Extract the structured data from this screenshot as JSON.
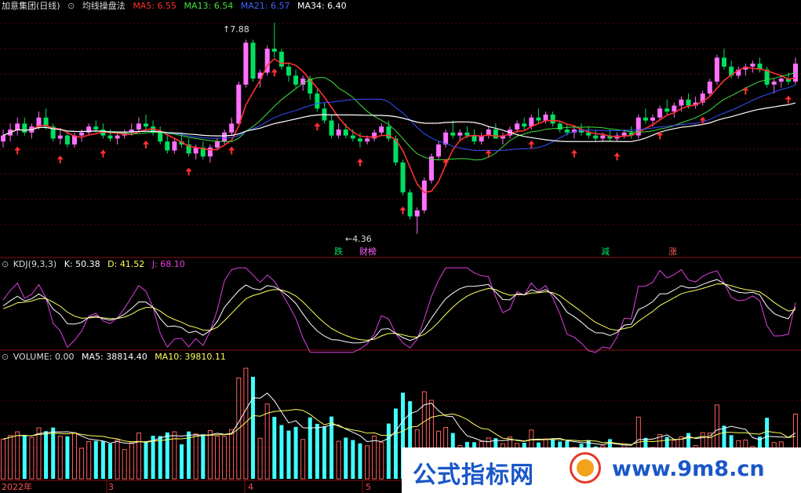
{
  "main_header": {
    "stock": "加意集团(日线)",
    "indicator": "均线操盘法",
    "ma5": "MA5: 6.55",
    "ma13": "MA13: 6.54",
    "ma21": "MA21: 6.57",
    "ma34": "MA34: 6.40"
  },
  "kdj_header": {
    "name": "KDJ(9,3,3)",
    "k": "K: 50.38",
    "d": "D: 41.52",
    "j": "J: 68.10"
  },
  "vol_header": {
    "name": "VOLUME: 0.00",
    "ma5": "MA5: 38814.40",
    "ma10": "MA10: 39810.11"
  },
  "annotations": {
    "high": "7.88",
    "low": "4.36"
  },
  "signals": [
    {
      "text": "跌",
      "color": "#00e060"
    },
    {
      "text": "财榜",
      "color": "#ff60ff"
    },
    {
      "text": "減",
      "color": "#00e060"
    },
    {
      "text": "涨",
      "color": "#ff6060"
    }
  ],
  "x_axis_labels": [
    "2022年",
    "3",
    "4",
    "5"
  ],
  "watermark": {
    "text1": "公式指标网",
    "text2": "www.9m8.cn"
  },
  "colors": {
    "up": "#ff70ff",
    "down": "#00e060",
    "ma5": "#ff3030",
    "ma13": "#40e040",
    "ma21": "#3050ff",
    "ma34": "#ffffff",
    "k": "#ffffff",
    "d": "#ffff60",
    "j": "#e040e0",
    "vol_up": "#ff6060",
    "vol_down": "#40ffff"
  },
  "chart_data": [
    {
      "type": "candlestick",
      "title": "均线操盘法",
      "series": [
        {
          "name": "MA5",
          "values": [
            6.55
          ]
        },
        {
          "name": "MA13",
          "values": [
            6.54
          ]
        },
        {
          "name": "MA21",
          "values": [
            6.57
          ]
        },
        {
          "name": "MA34",
          "values": [
            6.4
          ]
        }
      ],
      "ohlc": [
        [
          5.9,
          6.1,
          5.8,
          6.0
        ],
        [
          6.0,
          6.2,
          5.9,
          6.1
        ],
        [
          6.1,
          6.3,
          6.0,
          6.2
        ],
        [
          6.2,
          6.3,
          6.0,
          6.05
        ],
        [
          6.05,
          6.2,
          5.95,
          6.15
        ],
        [
          6.15,
          6.4,
          6.1,
          6.3
        ],
        [
          6.3,
          6.45,
          6.1,
          6.15
        ],
        [
          6.15,
          6.2,
          5.9,
          5.95
        ],
        [
          5.95,
          6.1,
          5.85,
          6.0
        ],
        [
          6.0,
          6.05,
          5.8,
          5.85
        ],
        [
          5.85,
          6.05,
          5.8,
          6.0
        ],
        [
          6.0,
          6.1,
          5.9,
          6.05
        ],
        [
          6.05,
          6.2,
          6.0,
          6.15
        ],
        [
          6.15,
          6.25,
          6.05,
          6.1
        ],
        [
          6.1,
          6.2,
          5.95,
          6.0
        ],
        [
          6.0,
          6.1,
          5.9,
          5.95
        ],
        [
          5.95,
          6.05,
          5.85,
          6.0
        ],
        [
          6.0,
          6.1,
          5.95,
          6.05
        ],
        [
          6.05,
          6.2,
          6.0,
          6.1
        ],
        [
          6.1,
          6.3,
          6.05,
          6.2
        ],
        [
          6.2,
          6.35,
          6.1,
          6.15
        ],
        [
          6.15,
          6.25,
          6.0,
          6.05
        ],
        [
          6.05,
          6.15,
          5.85,
          5.9
        ],
        [
          5.9,
          6.0,
          5.7,
          5.75
        ],
        [
          5.75,
          5.95,
          5.7,
          5.9
        ],
        [
          5.9,
          6.05,
          5.8,
          5.85
        ],
        [
          5.85,
          5.95,
          5.65,
          5.7
        ],
        [
          5.7,
          5.85,
          5.6,
          5.8
        ],
        [
          5.8,
          5.9,
          5.6,
          5.65
        ],
        [
          5.65,
          5.85,
          5.55,
          5.8
        ],
        [
          5.8,
          5.95,
          5.75,
          5.9
        ],
        [
          5.9,
          6.1,
          5.85,
          6.05
        ],
        [
          6.05,
          6.3,
          6.0,
          6.2
        ],
        [
          6.2,
          6.9,
          6.15,
          6.85
        ],
        [
          6.85,
          7.6,
          6.8,
          7.55
        ],
        [
          7.55,
          7.6,
          6.9,
          6.95
        ],
        [
          6.95,
          7.1,
          6.8,
          7.05
        ],
        [
          7.05,
          7.5,
          7.0,
          7.45
        ],
        [
          7.45,
          7.88,
          7.3,
          7.4
        ],
        [
          7.4,
          7.45,
          7.1,
          7.15
        ],
        [
          7.15,
          7.2,
          6.9,
          7.0
        ],
        [
          7.0,
          7.1,
          6.8,
          6.85
        ],
        [
          6.85,
          7.0,
          6.75,
          6.95
        ],
        [
          6.95,
          7.0,
          6.6,
          6.7
        ],
        [
          6.7,
          6.8,
          6.4,
          6.45
        ],
        [
          6.45,
          6.55,
          6.2,
          6.25
        ],
        [
          6.25,
          6.35,
          5.95,
          6.0
        ],
        [
          6.0,
          6.2,
          5.95,
          6.1
        ],
        [
          6.1,
          6.2,
          5.95,
          6.0
        ],
        [
          6.0,
          6.1,
          5.9,
          5.95
        ],
        [
          5.95,
          6.05,
          5.8,
          5.9
        ],
        [
          5.9,
          6.0,
          5.85,
          5.95
        ],
        [
          5.95,
          6.1,
          5.9,
          6.05
        ],
        [
          6.05,
          6.2,
          6.0,
          6.15
        ],
        [
          6.15,
          6.25,
          5.9,
          5.95
        ],
        [
          5.95,
          6.0,
          5.5,
          5.55
        ],
        [
          5.55,
          5.6,
          5.0,
          5.05
        ],
        [
          5.05,
          5.1,
          4.6,
          4.65
        ],
        [
          4.65,
          4.8,
          4.36,
          4.75
        ],
        [
          4.75,
          5.3,
          4.7,
          5.25
        ],
        [
          5.25,
          5.7,
          5.2,
          5.65
        ],
        [
          5.65,
          5.9,
          5.6,
          5.85
        ],
        [
          5.85,
          6.1,
          5.8,
          6.05
        ],
        [
          6.05,
          6.25,
          5.95,
          6.0
        ],
        [
          6.0,
          6.1,
          5.9,
          6.05
        ],
        [
          6.05,
          6.15,
          5.95,
          6.0
        ],
        [
          6.0,
          6.1,
          5.85,
          5.9
        ],
        [
          5.9,
          6.05,
          5.85,
          6.0
        ],
        [
          6.0,
          6.15,
          5.95,
          6.1
        ],
        [
          6.1,
          6.2,
          5.95,
          5.95
        ],
        [
          5.95,
          6.05,
          5.85,
          6.0
        ],
        [
          6.0,
          6.15,
          5.95,
          6.1
        ],
        [
          6.1,
          6.25,
          6.05,
          6.2
        ],
        [
          6.2,
          6.3,
          6.1,
          6.15
        ],
        [
          6.15,
          6.35,
          6.1,
          6.3
        ],
        [
          6.3,
          6.45,
          6.2,
          6.25
        ],
        [
          6.25,
          6.4,
          6.2,
          6.35
        ],
        [
          6.35,
          6.4,
          6.15,
          6.2
        ],
        [
          6.2,
          6.25,
          6.05,
          6.1
        ],
        [
          6.1,
          6.2,
          6.0,
          6.05
        ],
        [
          6.05,
          6.15,
          5.95,
          6.1
        ],
        [
          6.1,
          6.2,
          6.0,
          6.05
        ],
        [
          6.05,
          6.15,
          5.95,
          6.0
        ],
        [
          6.0,
          6.1,
          5.9,
          5.95
        ],
        [
          5.95,
          6.05,
          5.9,
          6.0
        ],
        [
          6.0,
          6.1,
          5.9,
          5.95
        ],
        [
          5.95,
          6.05,
          5.9,
          6.0
        ],
        [
          6.0,
          6.1,
          5.95,
          6.05
        ],
        [
          6.05,
          6.15,
          5.95,
          6.0
        ],
        [
          6.0,
          6.35,
          5.95,
          6.3
        ],
        [
          6.3,
          6.45,
          6.2,
          6.25
        ],
        [
          6.25,
          6.35,
          6.15,
          6.3
        ],
        [
          6.3,
          6.5,
          6.25,
          6.45
        ],
        [
          6.45,
          6.6,
          6.35,
          6.4
        ],
        [
          6.4,
          6.55,
          6.3,
          6.5
        ],
        [
          6.5,
          6.65,
          6.4,
          6.6
        ],
        [
          6.6,
          6.7,
          6.45,
          6.5
        ],
        [
          6.5,
          6.65,
          6.45,
          6.55
        ],
        [
          6.55,
          6.75,
          6.5,
          6.7
        ],
        [
          6.7,
          6.95,
          6.65,
          6.9
        ],
        [
          6.9,
          7.35,
          6.85,
          7.3
        ],
        [
          7.3,
          7.45,
          7.1,
          7.15
        ],
        [
          7.15,
          7.25,
          6.95,
          7.0
        ],
        [
          7.0,
          7.15,
          6.95,
          7.1
        ],
        [
          7.1,
          7.2,
          7.0,
          7.15
        ],
        [
          7.15,
          7.25,
          7.05,
          7.2
        ],
        [
          7.2,
          7.3,
          7.05,
          7.1
        ],
        [
          7.1,
          7.15,
          6.8,
          6.85
        ],
        [
          6.85,
          6.95,
          6.7,
          6.9
        ],
        [
          6.9,
          7.0,
          6.8,
          6.95
        ],
        [
          6.95,
          7.05,
          6.85,
          6.9
        ],
        [
          6.9,
          7.3,
          6.85,
          7.2
        ]
      ]
    },
    {
      "type": "line",
      "title": "KDJ(9,3,3)",
      "series": [
        {
          "name": "K",
          "values": [
            50.38
          ]
        },
        {
          "name": "D",
          "values": [
            41.52
          ]
        },
        {
          "name": "J",
          "values": [
            68.1
          ]
        }
      ]
    },
    {
      "type": "bar",
      "title": "VOLUME",
      "series": [
        {
          "name": "MA5",
          "values": [
            38814.4
          ]
        },
        {
          "name": "MA10",
          "values": [
            39810.11
          ]
        }
      ]
    }
  ]
}
